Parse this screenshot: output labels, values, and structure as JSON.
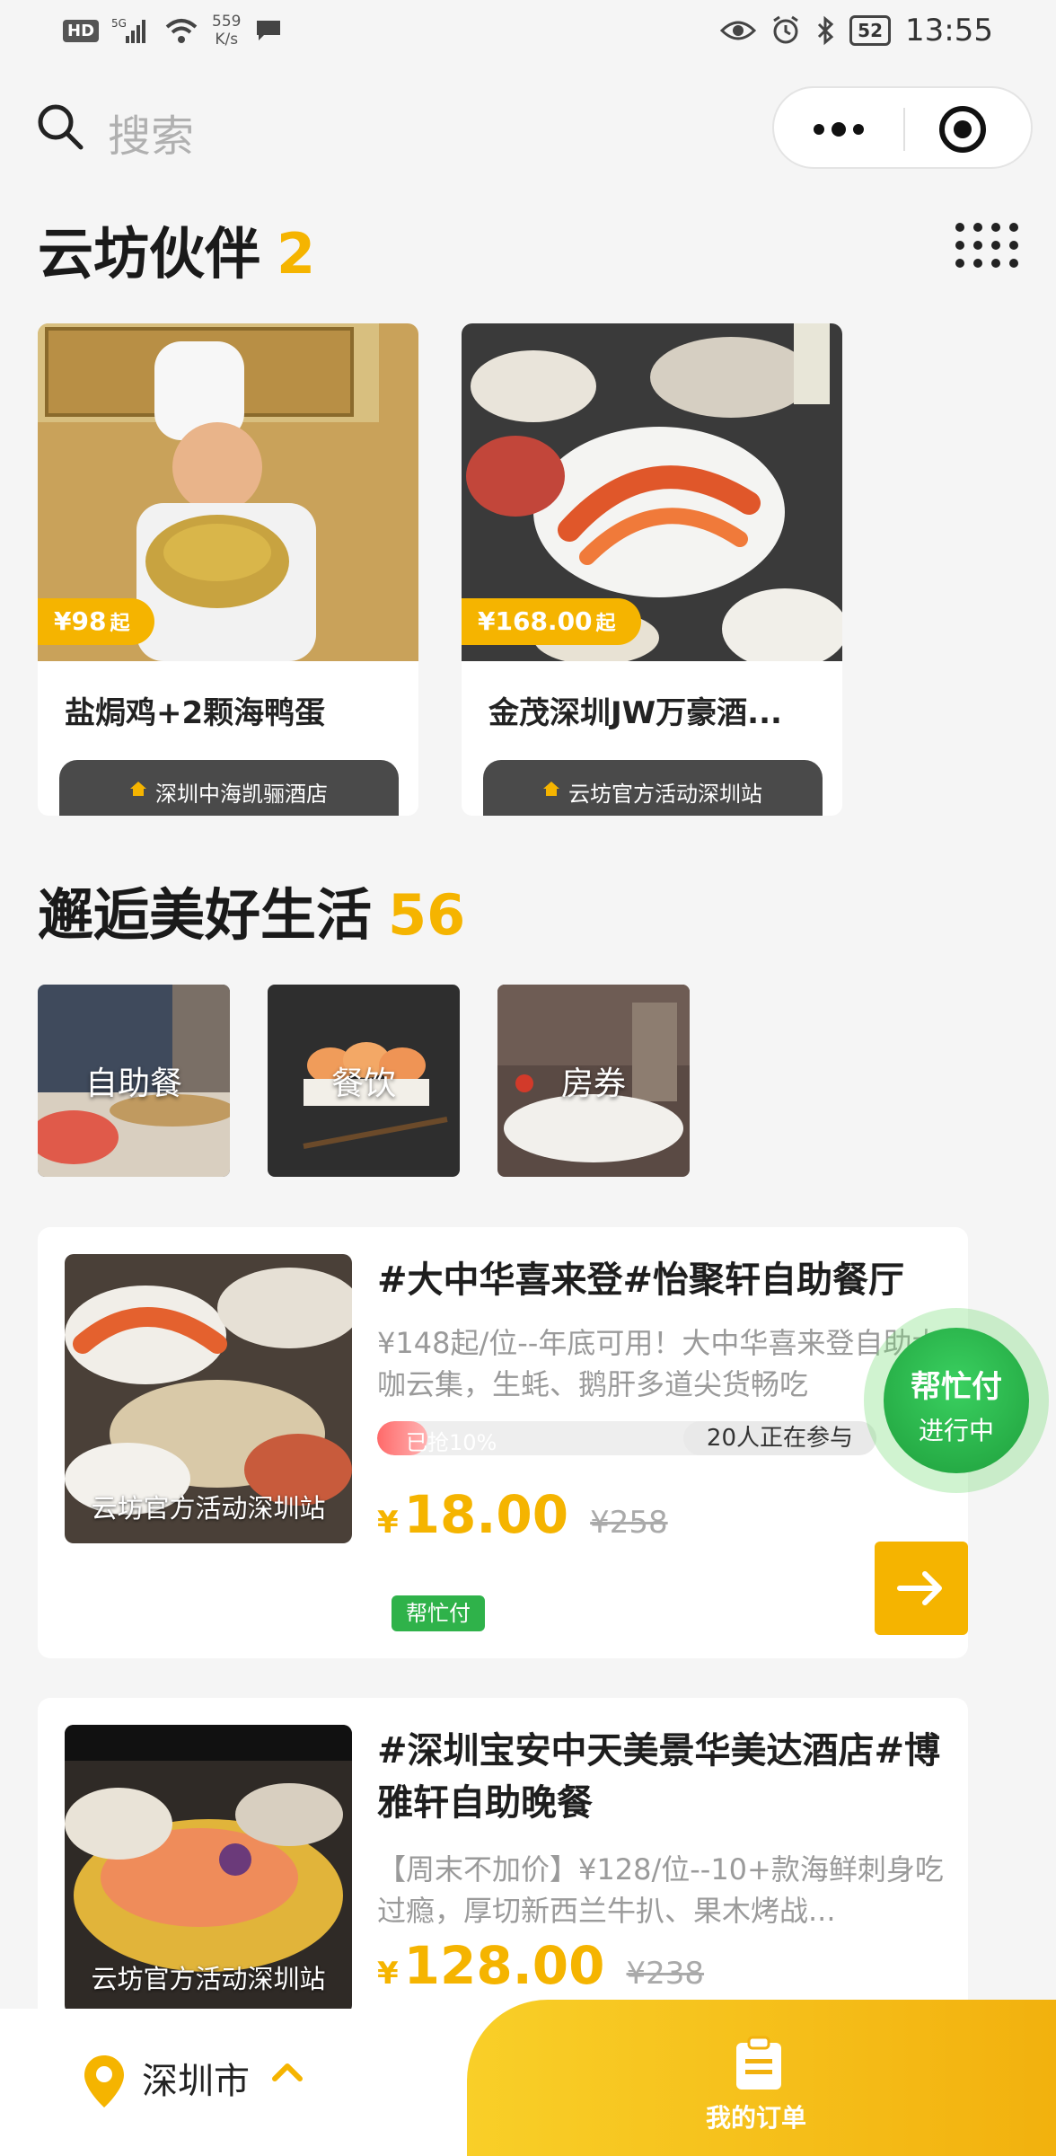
{
  "status_bar": {
    "hd": "HD",
    "network": "5G",
    "speed_value": "559",
    "speed_unit": "K/s",
    "battery": "52",
    "time": "13:55"
  },
  "search": {
    "placeholder": "搜索"
  },
  "partners": {
    "title": "云坊伙伴",
    "count": "2",
    "items": [
      {
        "price": "¥98",
        "suffix": "起",
        "name": "盐焗鸡+2颗海鸭蛋",
        "store": "深圳中海凯骊酒店"
      },
      {
        "price": "¥168.00",
        "suffix": "起",
        "name": "金茂深圳JW万豪酒...",
        "store": "云坊官方活动深圳站"
      }
    ]
  },
  "life": {
    "title": "邂逅美好生活",
    "count": "56",
    "categories": [
      {
        "label": "自助餐"
      },
      {
        "label": "餐饮"
      },
      {
        "label": "房券"
      }
    ]
  },
  "deals": [
    {
      "image_caption": "云坊官方活动深圳站",
      "title": "#大中华喜来登#怡聚轩自助餐厅",
      "desc": "¥148起/位--年底可用！大中华喜来登自助大咖云集，生蚝、鹅肝多道尖货畅吃",
      "progress_label": "已抢10%",
      "progress": 0.1,
      "participants": "20人正在参与",
      "price_symbol": "¥",
      "price": "18.00",
      "original_price": "¥258",
      "tag": "帮忙付"
    },
    {
      "image_caption": "云坊官方活动深圳站",
      "title": "#深圳宝安中天美景华美达酒店#博雅轩自助晚餐",
      "desc": "【周末不加价】¥128/位--10+款海鲜刺身吃过瘾，厚切新西兰牛扒、果木烤战...",
      "price_symbol": "¥",
      "price": "128.00",
      "original_price": "¥238"
    }
  ],
  "help_pay_badge": {
    "title": "帮忙付",
    "status": "进行中"
  },
  "bottom_bar": {
    "city": "深圳市",
    "orders_label": "我的订单"
  },
  "colors": {
    "accent": "#f5b400",
    "green": "#2fb24a",
    "dark_badge": "#4a4a4a"
  }
}
